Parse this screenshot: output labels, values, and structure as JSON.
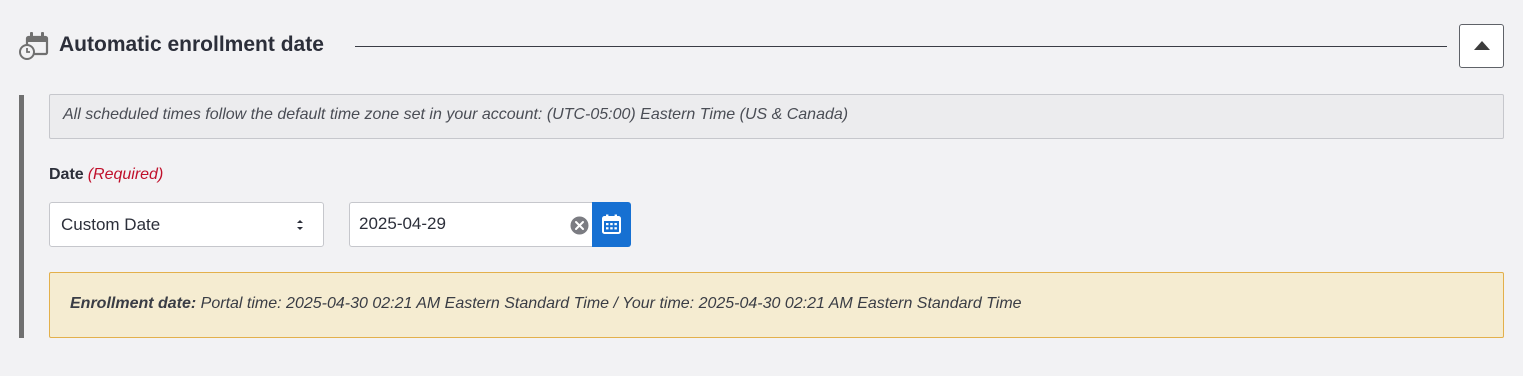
{
  "section": {
    "title": "Automatic enrollment date",
    "icon": "calendar-clock-icon",
    "collapse_icon": "triangle-up-icon"
  },
  "timezone_notice": "All scheduled times follow the default time zone set in your account: (UTC-05:00) Eastern Time (US & Canada)",
  "date_field": {
    "label": "Date",
    "required_text": "(Required)",
    "select": {
      "selected": "Custom Date",
      "icon": "select-arrows-icon"
    },
    "date_input": {
      "value": "2025-04-29",
      "clear_icon": "clear-circle-icon",
      "picker_icon": "calendar-icon"
    }
  },
  "enrollment_notice": {
    "lead": "Enrollment date:",
    "text": " Portal time: 2025-04-30 02:21 AM Eastern Standard Time / Your time: 2025-04-30 02:21 AM Eastern Standard Time"
  },
  "colors": {
    "accent": "#1670d2",
    "required": "#c0102b",
    "notice_bg": "#f5ecd1",
    "notice_border": "#e3b04b"
  }
}
